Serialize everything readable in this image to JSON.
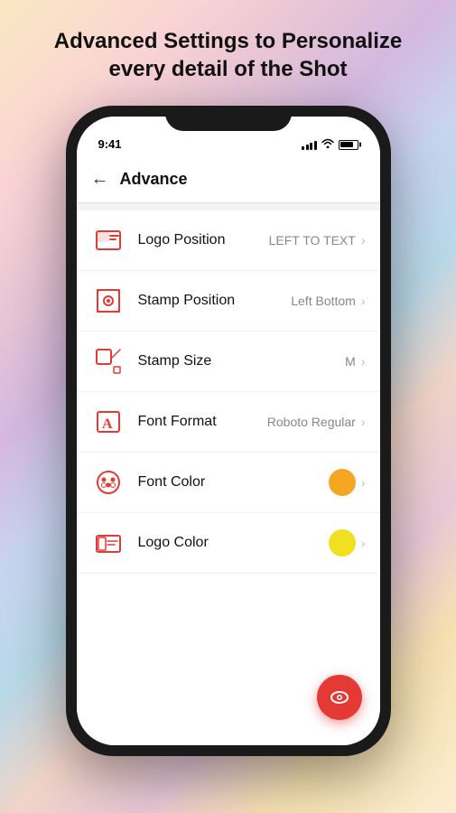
{
  "page": {
    "header": "Advanced Settings to Personalize every detail of the Shot",
    "accent_color": "#e53935"
  },
  "statusBar": {
    "time": "9:41"
  },
  "nav": {
    "title": "Advance",
    "back_label": "←"
  },
  "settings": [
    {
      "id": "logo-position",
      "label": "Logo Position",
      "value": "LEFT TO TEXT",
      "type": "nav",
      "icon": "logo-position-icon"
    },
    {
      "id": "stamp-position",
      "label": "Stamp Position",
      "value": "Left Bottom",
      "type": "nav",
      "icon": "stamp-position-icon"
    },
    {
      "id": "stamp-size",
      "label": "Stamp Size",
      "value": "M",
      "type": "nav",
      "icon": "stamp-size-icon"
    },
    {
      "id": "font-format",
      "label": "Font Format",
      "value": "Roboto Regular",
      "type": "nav",
      "icon": "font-format-icon"
    },
    {
      "id": "font-color",
      "label": "Font Color",
      "value": "#f5a623",
      "type": "color",
      "icon": "font-color-icon"
    },
    {
      "id": "logo-color",
      "label": "Logo Color",
      "value": "#f0e020",
      "type": "color",
      "icon": "logo-color-icon"
    }
  ],
  "fab": {
    "icon": "eye-icon"
  }
}
